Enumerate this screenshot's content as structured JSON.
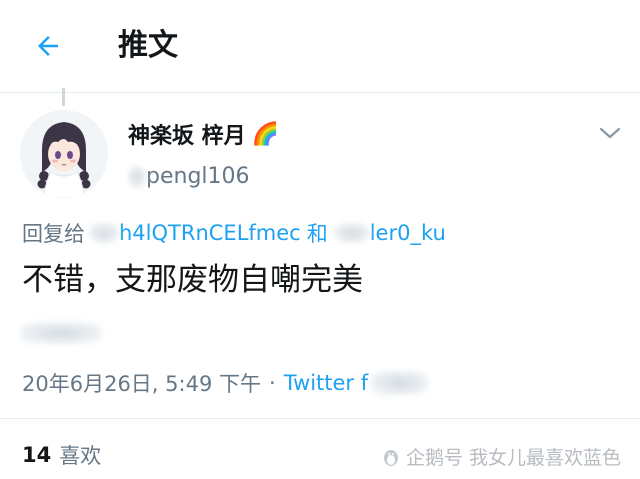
{
  "header": {
    "title": "推文",
    "back_icon": "arrow-left-icon",
    "accent": "#1da1f2"
  },
  "tweet": {
    "display_name": "神楽坂 梓月",
    "name_emoji": "🌈",
    "handle_visible": "pengl106",
    "reply_label": "回复给",
    "mention_1": "h4lQTRnCELfmec",
    "mention_joiner": "和",
    "mention_2": "ler0_ku",
    "text": "不错，支那废物自嘲完美",
    "timestamp": "20年6月26日, 5:49 下午",
    "separator": "·",
    "source": "Twitter f"
  },
  "stats": {
    "likes_count": "14",
    "likes_label": "喜欢"
  },
  "watermark": {
    "text": "企鹅号 我女儿最喜欢蓝色"
  },
  "colors": {
    "text": "#14171a",
    "secondary": "#657786",
    "link": "#1da1f2",
    "divider": "#e6ecf0"
  }
}
